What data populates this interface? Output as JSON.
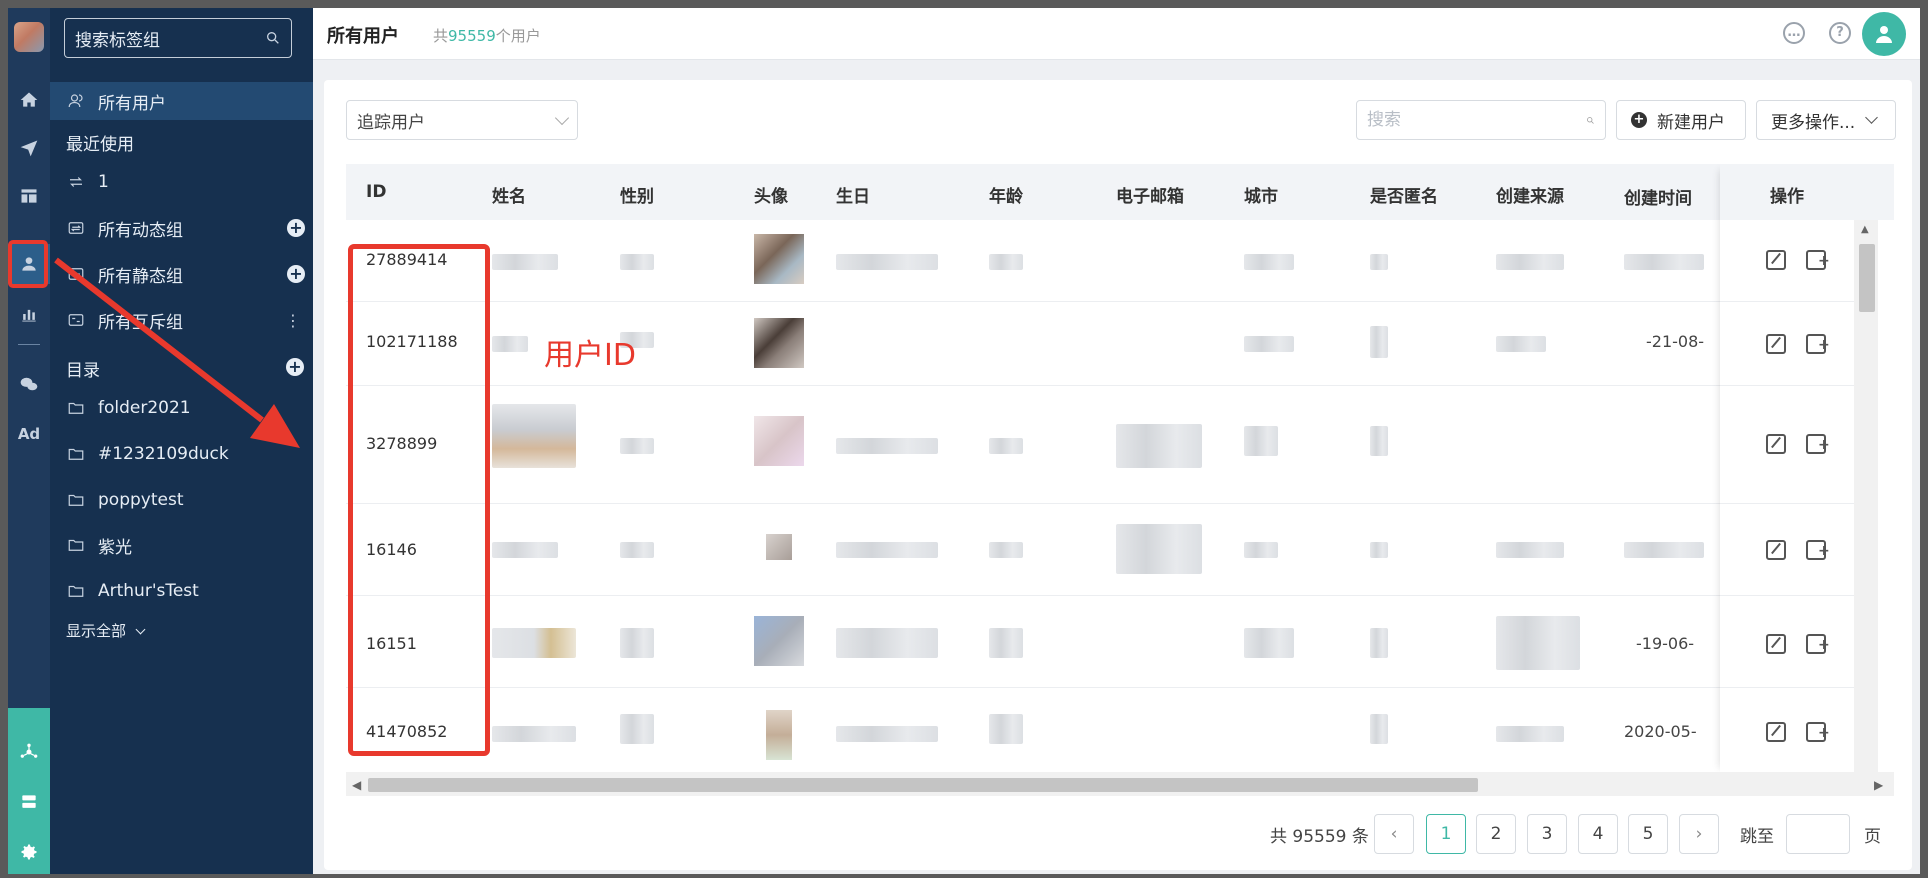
{
  "sidebar": {
    "search_placeholder": "搜索标签组",
    "all_users": "所有用户",
    "recent_heading": "最近使用",
    "recent_item": "1",
    "dynamic_groups": "所有动态组",
    "static_groups": "所有静态组",
    "exclusive_groups": "所有互斥组",
    "directory_heading": "目录",
    "folders": [
      "folder2021",
      "#1232109duck",
      "poppytest",
      "紫光",
      "Arthur'sTest"
    ],
    "show_all": "显示全部"
  },
  "rail": {
    "ad_label": "Ad"
  },
  "header": {
    "title": "所有用户",
    "count_prefix": "共",
    "count_value": "95559",
    "count_suffix": "个用户"
  },
  "toolbar": {
    "filter_value": "追踪用户",
    "search_placeholder": "搜索",
    "new_user_label": "新建用户",
    "more_actions_label": "更多操作..."
  },
  "table": {
    "columns": [
      "ID",
      "姓名",
      "性别",
      "头像",
      "生日",
      "年龄",
      "电子邮箱",
      "城市",
      "是否匿名",
      "创建来源",
      "创建时间",
      "操作"
    ],
    "rows": [
      {
        "id": "27889414",
        "created": ""
      },
      {
        "id": "102171188",
        "created": "-21-08-"
      },
      {
        "id": "3278899",
        "created": ""
      },
      {
        "id": "16146",
        "created": ""
      },
      {
        "id": "16151",
        "created": "-19-06-"
      },
      {
        "id": "41470852",
        "created": "2020-05-"
      }
    ]
  },
  "annotation": {
    "label": "用户ID",
    "color": "#e8392d"
  },
  "pagination": {
    "total": "共 95559 条",
    "pages": [
      "1",
      "2",
      "3",
      "4",
      "5"
    ],
    "current": "1",
    "jump_label": "跳至",
    "page_label": "页"
  },
  "colors": {
    "accent": "#3fb8a6",
    "sidebar": "#16304f",
    "rail": "#1f3a5c"
  }
}
